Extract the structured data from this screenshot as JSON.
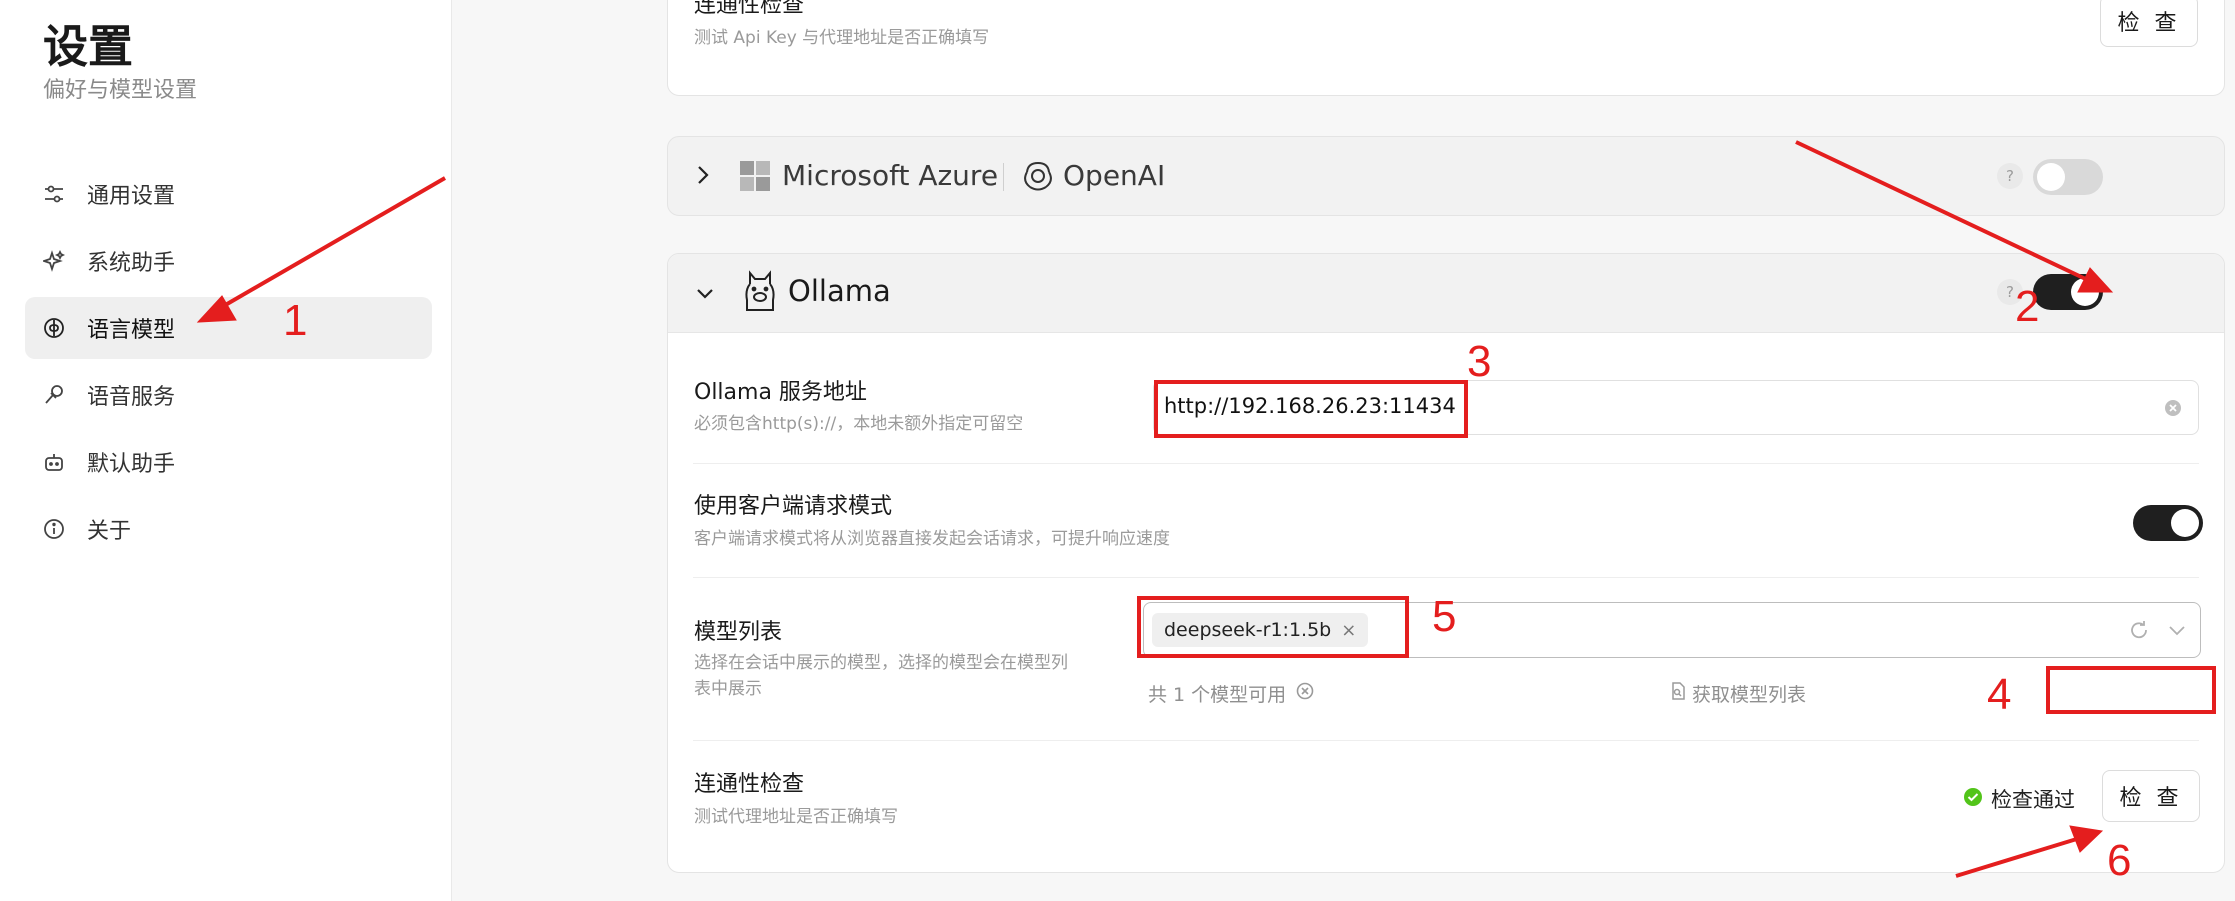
{
  "sidebar": {
    "title": "设置",
    "subtitle": "偏好与模型设置",
    "items": [
      {
        "label": "通用设置"
      },
      {
        "label": "系统助手"
      },
      {
        "label": "语言模型"
      },
      {
        "label": "语音服务"
      },
      {
        "label": "默认助手"
      },
      {
        "label": "关于"
      }
    ]
  },
  "top_card": {
    "title": "连通性检查",
    "desc": "测试 Api Key 与代理地址是否正确填写",
    "button": "检 查"
  },
  "azure": {
    "brand1": "Microsoft Azure",
    "brand2": "OpenAI",
    "help": "?",
    "enabled": false
  },
  "ollama": {
    "name": "Ollama",
    "help": "?",
    "enabled": true,
    "endpoint": {
      "title": "Ollama 服务地址",
      "desc": "必须包含http(s)://，本地未额外指定可留空",
      "value": "http://192.168.26.23:11434"
    },
    "client_mode": {
      "title": "使用客户端请求模式",
      "desc": "客户端请求模式将从浏览器直接发起会话请求，可提升响应速度",
      "enabled": true
    },
    "models": {
      "title": "模型列表",
      "desc_line1": "选择在会话中展示的模型，选择的模型会在模型列",
      "desc_line2": "表中展示",
      "tag": "deepseek-r1:1.5b",
      "count_text": "共 1 个模型可用",
      "fetch_label": "获取模型列表"
    },
    "connectivity": {
      "title": "连通性检查",
      "desc": "测试代理地址是否正确填写",
      "status": "检查通过",
      "button": "检 查"
    }
  },
  "annotations": [
    "1",
    "2",
    "3",
    "4",
    "5",
    "6"
  ],
  "colors": {
    "annotation": "#e41e1e",
    "toggle_on": "#1f1f1f",
    "success": "#52c41a"
  }
}
